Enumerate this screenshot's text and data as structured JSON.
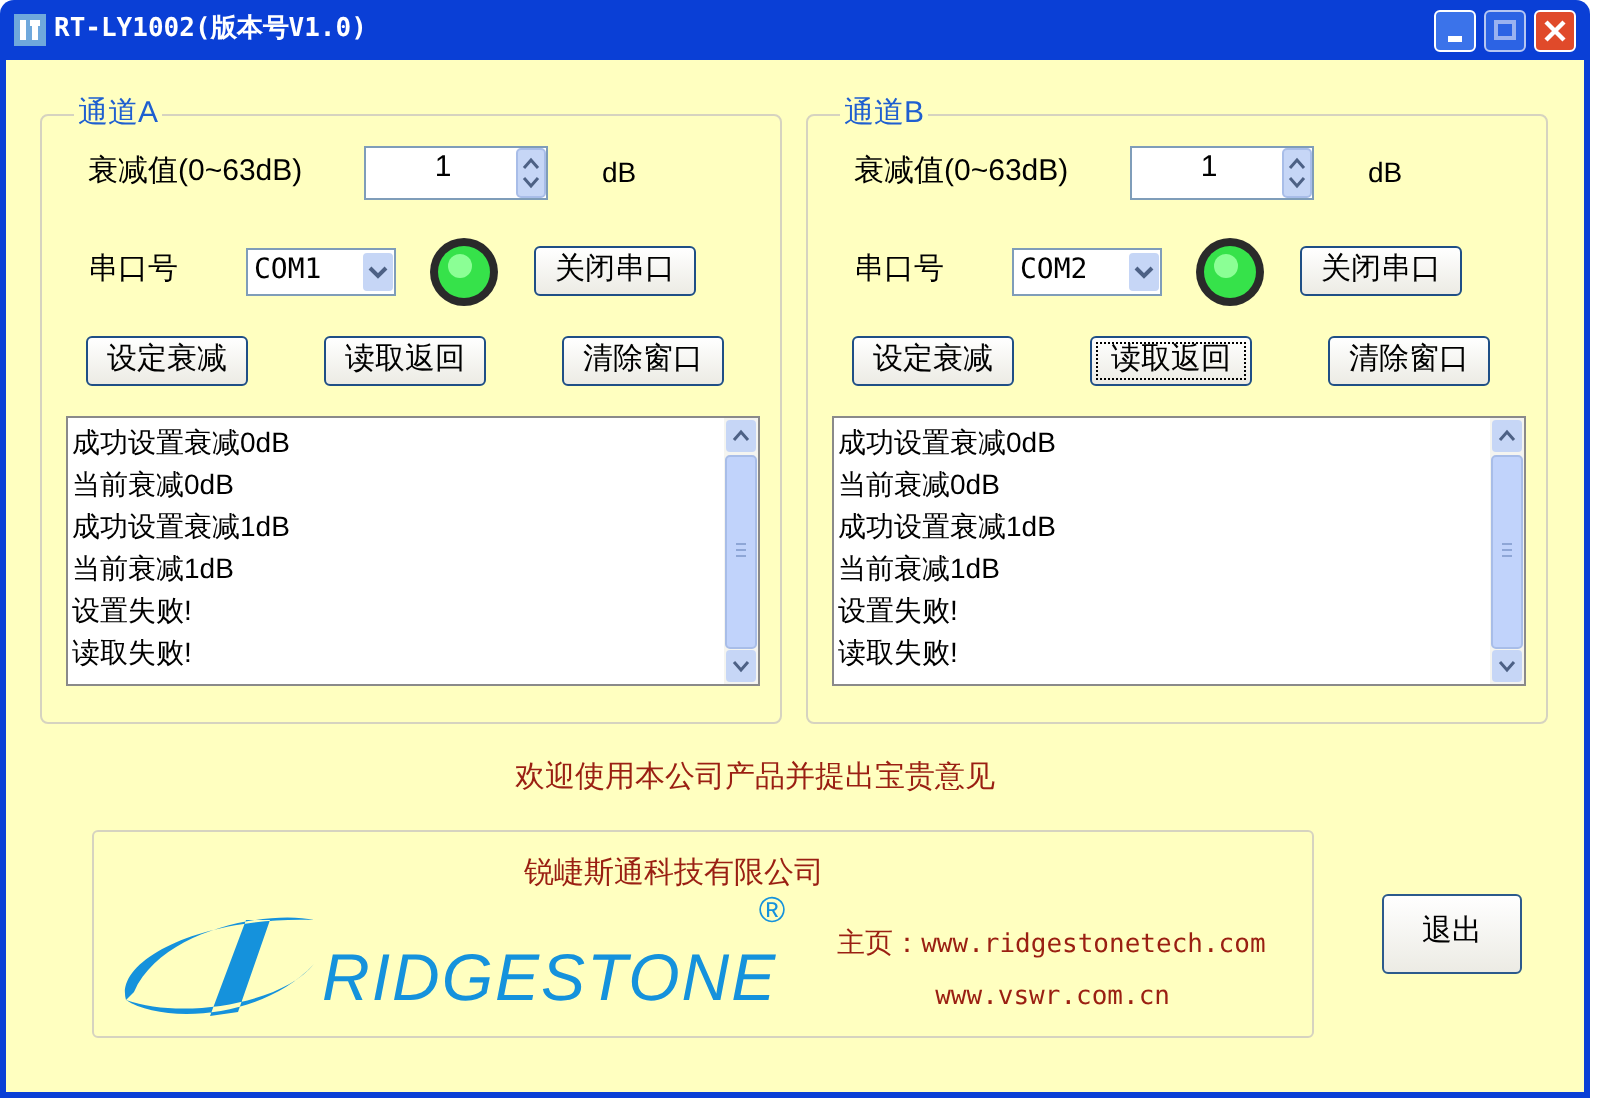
{
  "window": {
    "title": "RT-LY1002(版本号V1.0)"
  },
  "channels": [
    {
      "legend": "通道A",
      "attenuation_label": "衰减值(0~63dB)",
      "attenuation_value": "1",
      "unit": "dB",
      "port_label": "串口号",
      "port": "COM1",
      "led_on": true,
      "port_button": "关闭串口",
      "buttons": [
        {
          "label": "设定衰减",
          "focused": false
        },
        {
          "label": "读取返回",
          "focused": false
        },
        {
          "label": "清除窗口",
          "focused": false
        }
      ],
      "log": [
        "成功设置衰减0dB",
        "当前衰减0dB",
        "成功设置衰减1dB",
        "当前衰减1dB",
        "设置失败!",
        "读取失败!"
      ]
    },
    {
      "legend": "通道B",
      "attenuation_label": "衰减值(0~63dB)",
      "attenuation_value": "1",
      "unit": "dB",
      "port_label": "串口号",
      "port": "COM2",
      "led_on": true,
      "port_button": "关闭串口",
      "buttons": [
        {
          "label": "设定衰减",
          "focused": false
        },
        {
          "label": "读取返回",
          "focused": true
        },
        {
          "label": "清除窗口",
          "focused": false
        }
      ],
      "log": [
        "成功设置衰减0dB",
        "当前衰减0dB",
        "成功设置衰减1dB",
        "当前衰减1dB",
        "设置失败!",
        "读取失败!"
      ]
    }
  ],
  "welcome": "欢迎使用本公司产品并提出宝贵意见",
  "company": {
    "name": "锐崨斯通科技有限公司",
    "logo_text": "RIDGESTONE",
    "logo_mark": "®",
    "homepage_label": "主页：",
    "urls": [
      "www.ridgestonetech.com",
      "www.vswr.com.cn"
    ]
  },
  "exit_button": "退出"
}
